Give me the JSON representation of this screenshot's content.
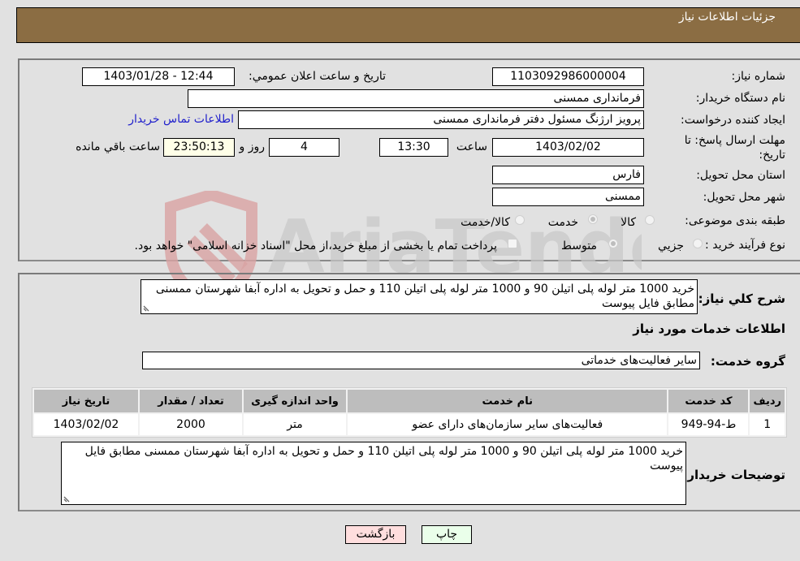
{
  "header": {
    "title": "جزئیات اطلاعات نیاز"
  },
  "form": {
    "need_number": {
      "label": "شماره نیاز:",
      "value": "1103092986000004"
    },
    "announce_datetime": {
      "label": "تاريخ و ساعت اعلان عمومي:",
      "value": "1403/01/28 - 12:44"
    },
    "buyer_org": {
      "label": "نام دستگاه خريدار:",
      "value": "فرمانداری ممسنی"
    },
    "requester": {
      "label": "ايجاد کننده درخواست:",
      "value": "پرویز ارژنگ مسئول دفتر فرمانداری ممسنی",
      "contact_link": "اطلاعات تماس خريدار"
    },
    "deadline": {
      "label_line1": "مهلت ارسال پاسخ: تا",
      "label_line2": "تاريخ:",
      "date": "1403/02/02",
      "time_label": "ساعت",
      "time": "13:30",
      "days": "4",
      "days_label": "روز و",
      "remaining_time": "23:50:13",
      "remaining_label": "ساعت باقي مانده"
    },
    "province": {
      "label": "استان محل تحويل:",
      "value": "فارس"
    },
    "city": {
      "label": "شهر محل تحويل:",
      "value": "ممسنی"
    },
    "category": {
      "label": "طبقه بندی موضوعی:",
      "options": [
        "کالا",
        "خدمت",
        "کالا/خدمت"
      ],
      "selected": "خدمت"
    },
    "purchase_process": {
      "label": "نوع فرآيند خريد :",
      "options": [
        "جزيي",
        "متوسط"
      ],
      "selected": "متوسط",
      "treasury_checkbox_label": "پرداخت تمام يا بخشی از مبلغ خريد،از محل \"اسناد خزانه اسلامی\" خواهد بود.",
      "treasury_checked": false
    }
  },
  "details": {
    "general_desc_label": "شرح کلي نياز:",
    "general_desc": "خرید 1000 متر لوله پلی اتیلن 90 و 1000 متر لوله پلی اتیلن 110 و حمل و تحویل به اداره آبفا شهرستان ممسنی مطابق فایل پیوست",
    "services_title": "اطلاعات خدمات مورد نياز",
    "service_group_label": "گروه خدمت:",
    "service_group": "سایر فعالیت‌های خدماتی",
    "table": {
      "headers": [
        "رديف",
        "کد خدمت",
        "نام خدمت",
        "واحد اندازه گيری",
        "تعداد / مقدار",
        "تاريخ نياز"
      ],
      "rows": [
        [
          "1",
          "ط-94-949",
          "فعالیت‌های سایر سازمان‌های دارای عضو",
          "متر",
          "2000",
          "1403/02/02"
        ]
      ]
    },
    "buyer_notes_label": "توضيحات خريدار:",
    "buyer_notes": "خرید 1000 متر لوله پلی اتیلن 90 و 1000 متر لوله پلی اتیلن 110 و حمل و تحویل به اداره آبفا شهرستان ممسنی مطابق فایل پیوست"
  },
  "buttons": {
    "print": "چاپ",
    "back": "بازگشت"
  },
  "watermark": {
    "text": "AriaTender.neT"
  },
  "colors": {
    "header_bg": "#8b6d43",
    "print_bg": "#eaffea",
    "back_bg": "#ffdede",
    "link": "#2222cc"
  }
}
